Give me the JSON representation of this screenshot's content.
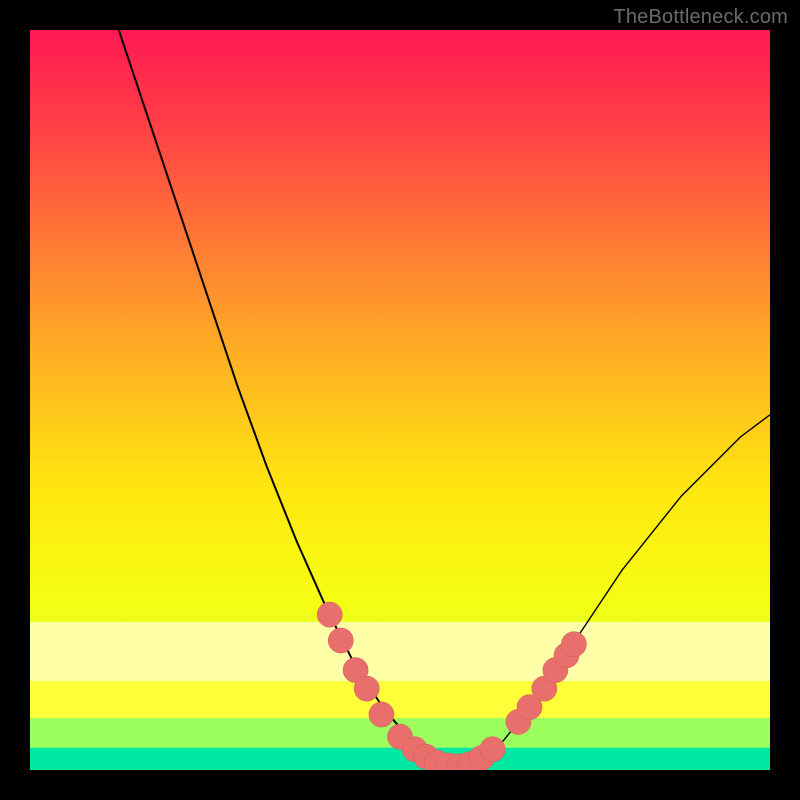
{
  "watermark": "TheBottleneck.com",
  "colors": {
    "frame": "#000000",
    "gradient_stops": [
      {
        "offset": 0.0,
        "color": "#ff1a53"
      },
      {
        "offset": 0.12,
        "color": "#ff3c47"
      },
      {
        "offset": 0.28,
        "color": "#ff7735"
      },
      {
        "offset": 0.45,
        "color": "#ffb222"
      },
      {
        "offset": 0.62,
        "color": "#ffe70f"
      },
      {
        "offset": 0.78,
        "color": "#f4ff12"
      },
      {
        "offset": 0.88,
        "color": "#c6ff4a"
      },
      {
        "offset": 0.94,
        "color": "#6eff8a"
      },
      {
        "offset": 1.0,
        "color": "#00e9a3"
      }
    ],
    "band_pale": "#ffffa8",
    "band_yellow": "#ffff3a",
    "band_lime": "#9cff5e",
    "band_green": "#00e8a2",
    "curve": "#000000",
    "marker_fill": "#e96f6d",
    "marker_stroke": "#d25a58"
  },
  "chart_data": {
    "type": "line",
    "title": "",
    "xlabel": "",
    "ylabel": "",
    "xlim": [
      0,
      100
    ],
    "ylim": [
      0,
      100
    ],
    "left_curve": [
      {
        "x": 12,
        "y": 100
      },
      {
        "x": 16,
        "y": 88
      },
      {
        "x": 20,
        "y": 76
      },
      {
        "x": 24,
        "y": 64
      },
      {
        "x": 28,
        "y": 52
      },
      {
        "x": 32,
        "y": 41
      },
      {
        "x": 36,
        "y": 31
      },
      {
        "x": 40,
        "y": 22
      },
      {
        "x": 44,
        "y": 14
      },
      {
        "x": 48,
        "y": 8
      },
      {
        "x": 52,
        "y": 3.5
      },
      {
        "x": 55,
        "y": 1.2
      },
      {
        "x": 58,
        "y": 0.5
      }
    ],
    "right_curve": [
      {
        "x": 58,
        "y": 0.5
      },
      {
        "x": 61,
        "y": 1.4
      },
      {
        "x": 64,
        "y": 4
      },
      {
        "x": 68,
        "y": 9
      },
      {
        "x": 72,
        "y": 15
      },
      {
        "x": 76,
        "y": 21
      },
      {
        "x": 80,
        "y": 27
      },
      {
        "x": 84,
        "y": 32
      },
      {
        "x": 88,
        "y": 37
      },
      {
        "x": 92,
        "y": 41
      },
      {
        "x": 96,
        "y": 45
      },
      {
        "x": 100,
        "y": 48
      }
    ],
    "markers": [
      {
        "x": 40.5,
        "y": 21
      },
      {
        "x": 42.0,
        "y": 17.5
      },
      {
        "x": 44.0,
        "y": 13.5
      },
      {
        "x": 45.5,
        "y": 11
      },
      {
        "x": 47.5,
        "y": 7.5
      },
      {
        "x": 50.0,
        "y": 4.5
      },
      {
        "x": 52.0,
        "y": 2.8
      },
      {
        "x": 53.5,
        "y": 1.8
      },
      {
        "x": 55.0,
        "y": 1.0
      },
      {
        "x": 56.5,
        "y": 0.6
      },
      {
        "x": 58.0,
        "y": 0.5
      },
      {
        "x": 59.5,
        "y": 0.8
      },
      {
        "x": 61.0,
        "y": 1.6
      },
      {
        "x": 62.5,
        "y": 2.8
      },
      {
        "x": 66.0,
        "y": 6.5
      },
      {
        "x": 67.5,
        "y": 8.5
      },
      {
        "x": 69.5,
        "y": 11
      },
      {
        "x": 71.0,
        "y": 13.5
      },
      {
        "x": 72.5,
        "y": 15.5
      },
      {
        "x": 73.5,
        "y": 17
      }
    ],
    "marker_radius": 1.7,
    "bottom_bands_y": [
      {
        "name": "pale",
        "y_top": 20,
        "y_bot": 12
      },
      {
        "name": "yellow",
        "y_top": 12,
        "y_bot": 7
      },
      {
        "name": "lime",
        "y_top": 7,
        "y_bot": 3
      },
      {
        "name": "green",
        "y_top": 3,
        "y_bot": 0
      }
    ]
  }
}
